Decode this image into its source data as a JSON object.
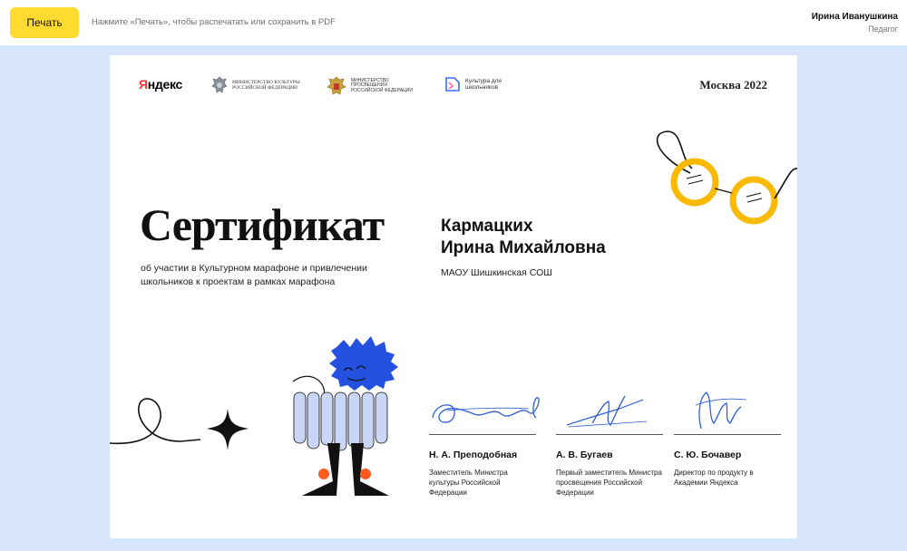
{
  "toolbar": {
    "print_label": "Печать",
    "hint": "Нажмите «Печать», чтобы распечатать или сохранить в PDF"
  },
  "user": {
    "name": "Ирина Иванушкина",
    "role": "Педагог"
  },
  "certificate": {
    "logos": {
      "yandex_first": "Я",
      "yandex_rest": "ндекс",
      "ministry_culture": "Министерство культуры Российской Федерации",
      "ministry_education": "Министерство просвещения Российской Федерации",
      "culture_kids": "Культура для школьников"
    },
    "city_year": "Москва 2022",
    "title": "Сертификат",
    "subtitle": "об участии в Культурном марафоне и привлечении школьников к проектам в рамках марафона",
    "recipient_surname": "Кармацких",
    "recipient_name": "Ирина Михайловна",
    "school": "МАОУ Шишкинская СОШ",
    "signatures": [
      {
        "name": "Н. А. Преподобная",
        "role": "Заместитель Министра культуры Российской Федерации"
      },
      {
        "name": "А. В. Бугаев",
        "role": "Первый заместитель Министра просвещения Российской Федерации"
      },
      {
        "name": "С. Ю. Бочавер",
        "role": "Директор по продукту в Академии Яндекса"
      }
    ]
  },
  "colors": {
    "accent_yellow": "#ffdb30",
    "page_background": "#d8e6fb",
    "signature_blue": "#2f5fd6",
    "glasses_yellow": "#fbb900",
    "character_blue": "#2551e0"
  },
  "icons": [
    "emblem-icon",
    "culture-kids-icon",
    "glasses-icon",
    "sparkle-icon",
    "character-illustration"
  ]
}
